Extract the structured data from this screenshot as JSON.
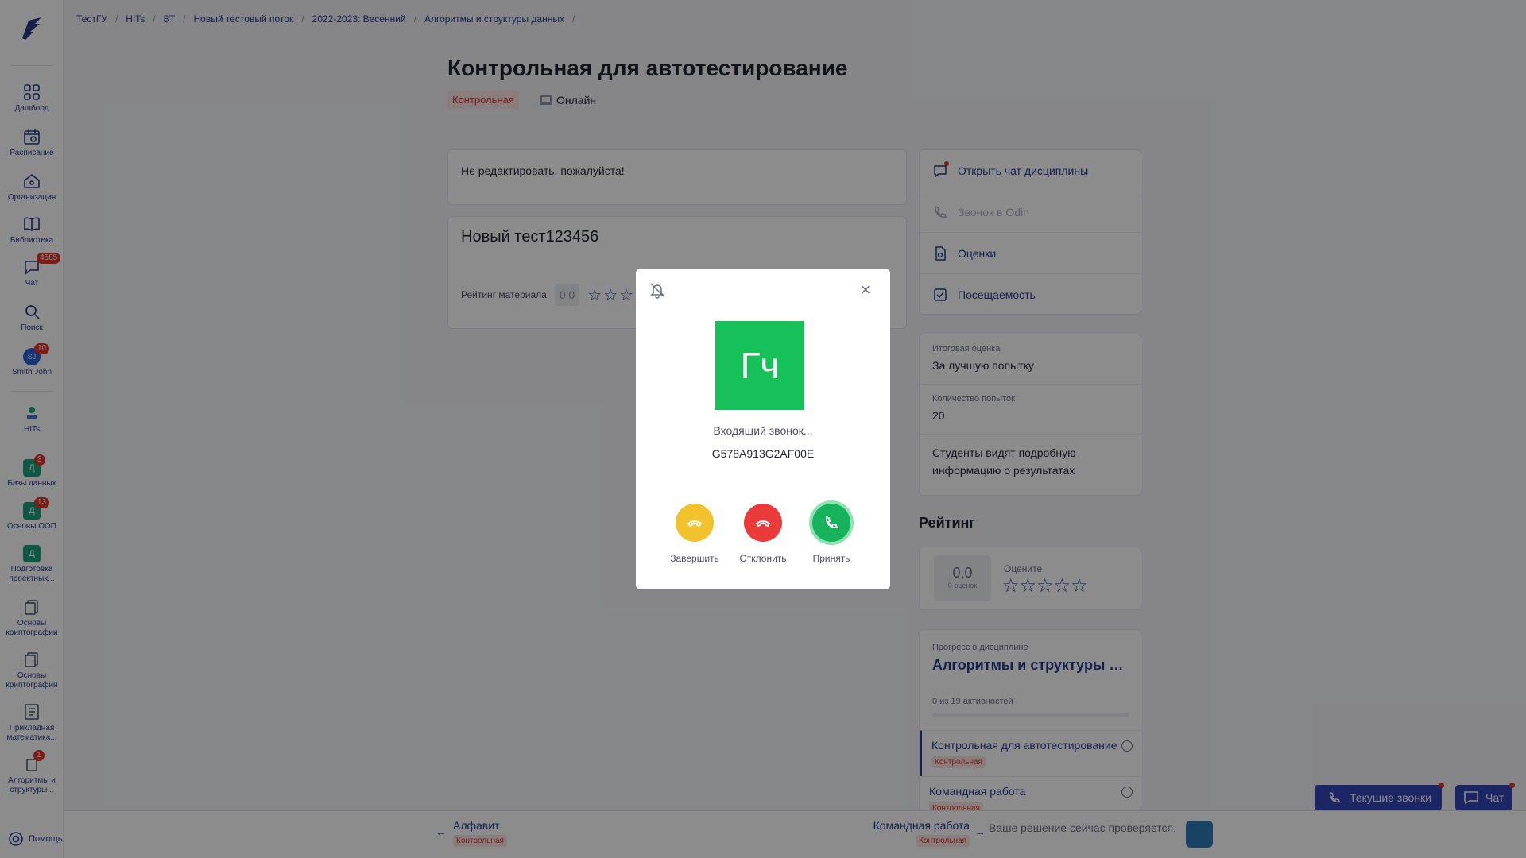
{
  "breadcrumb": [
    "ТестГУ",
    "HITs",
    "ВТ",
    "Новый тестовый поток",
    "2022-2023: Весенний",
    "Алгоритмы и структуры данных"
  ],
  "sidebar": {
    "items": [
      {
        "label": "Дашборд",
        "icon": "grid-icon"
      },
      {
        "label": "Расписание",
        "icon": "calendar-icon"
      },
      {
        "label": "Организация",
        "icon": "home-icon"
      },
      {
        "label": "Библиотека",
        "icon": "book-icon"
      },
      {
        "label": "Чат",
        "icon": "chat-icon",
        "badge": "4585"
      },
      {
        "label": "Поиск",
        "icon": "search-icon"
      },
      {
        "label": "Smith John",
        "avatar": "SJ",
        "badge": "10"
      },
      {
        "label": "HITs",
        "icon": "hits-icon"
      },
      {
        "label": "Базы данных",
        "square": "Д",
        "badge": "3"
      },
      {
        "label": "Основы ООП",
        "square": "Д",
        "badge": "13"
      },
      {
        "label": "Подготовка проектных...",
        "square": "Д"
      },
      {
        "label": "Основы криптографии",
        "icon": "course-icon"
      },
      {
        "label": "Основы криптографии",
        "icon": "course-icon"
      },
      {
        "label": "Прикладная математика...",
        "icon": "course-icon"
      },
      {
        "label": "Алгоритмы и структуры...",
        "icon": "course-icon",
        "badge": "1"
      }
    ],
    "help": "Помощь"
  },
  "header": {
    "title": "Контрольная для автотестирование",
    "tag": "Контрольная",
    "mode": "Онлайн"
  },
  "note": "Не редактировать, пожалуйста!",
  "test": {
    "title": "Новый тест123456",
    "rating_label": "Рейтинг материала",
    "rating_value": "0,0",
    "stars": "☆☆☆"
  },
  "right_links": [
    {
      "label": "Открыть чат дисциплины",
      "icon": "chat-icon"
    },
    {
      "label": "Звонок в Odin",
      "icon": "phone-icon"
    },
    {
      "label": "Оценки",
      "icon": "grades-icon"
    },
    {
      "label": "Посещаемость",
      "icon": "checkbox-icon"
    }
  ],
  "info": {
    "final_label": "Итоговая оценка",
    "final_value": "За лучшую попытку",
    "attempts_label": "Количество попыток",
    "attempts_value": "20",
    "details": "Студенты видят подробную информацию о результатах"
  },
  "rating": {
    "heading": "Рейтинг",
    "score": "0,0",
    "score_sub": "0 оценок",
    "rate_label": "Оцените",
    "stars": "☆☆☆☆☆"
  },
  "progress": {
    "label": "Прогресс в дисциплине",
    "title": "Алгоритмы и структуры данных",
    "count": "0 из 19 активностей",
    "fraction": 0,
    "items": [
      {
        "title": "Контрольная для автотестирование",
        "tag": "Контрольная"
      },
      {
        "title": "Командная работа",
        "tag": "Контрольная"
      }
    ]
  },
  "bottom": {
    "prev_title": "Алфавит",
    "prev_tag": "Контрольная",
    "next_title": "Командная работа",
    "next_tag": "Контрольная",
    "check_text": "Ваше решение сейчас проверяется.",
    "calls_button": "Текущие звонки",
    "chat_button": "Чат"
  },
  "modal": {
    "avatar_text": "Гч",
    "status": "Входящий звонок...",
    "caller_id": "G578A913G2AF00E",
    "btn_end": "Завершить",
    "btn_decline": "Отклонить",
    "btn_accept": "Принять",
    "colors": {
      "end": "#f2c12e",
      "decline": "#ea3a3a",
      "accept": "#17b35c"
    }
  }
}
